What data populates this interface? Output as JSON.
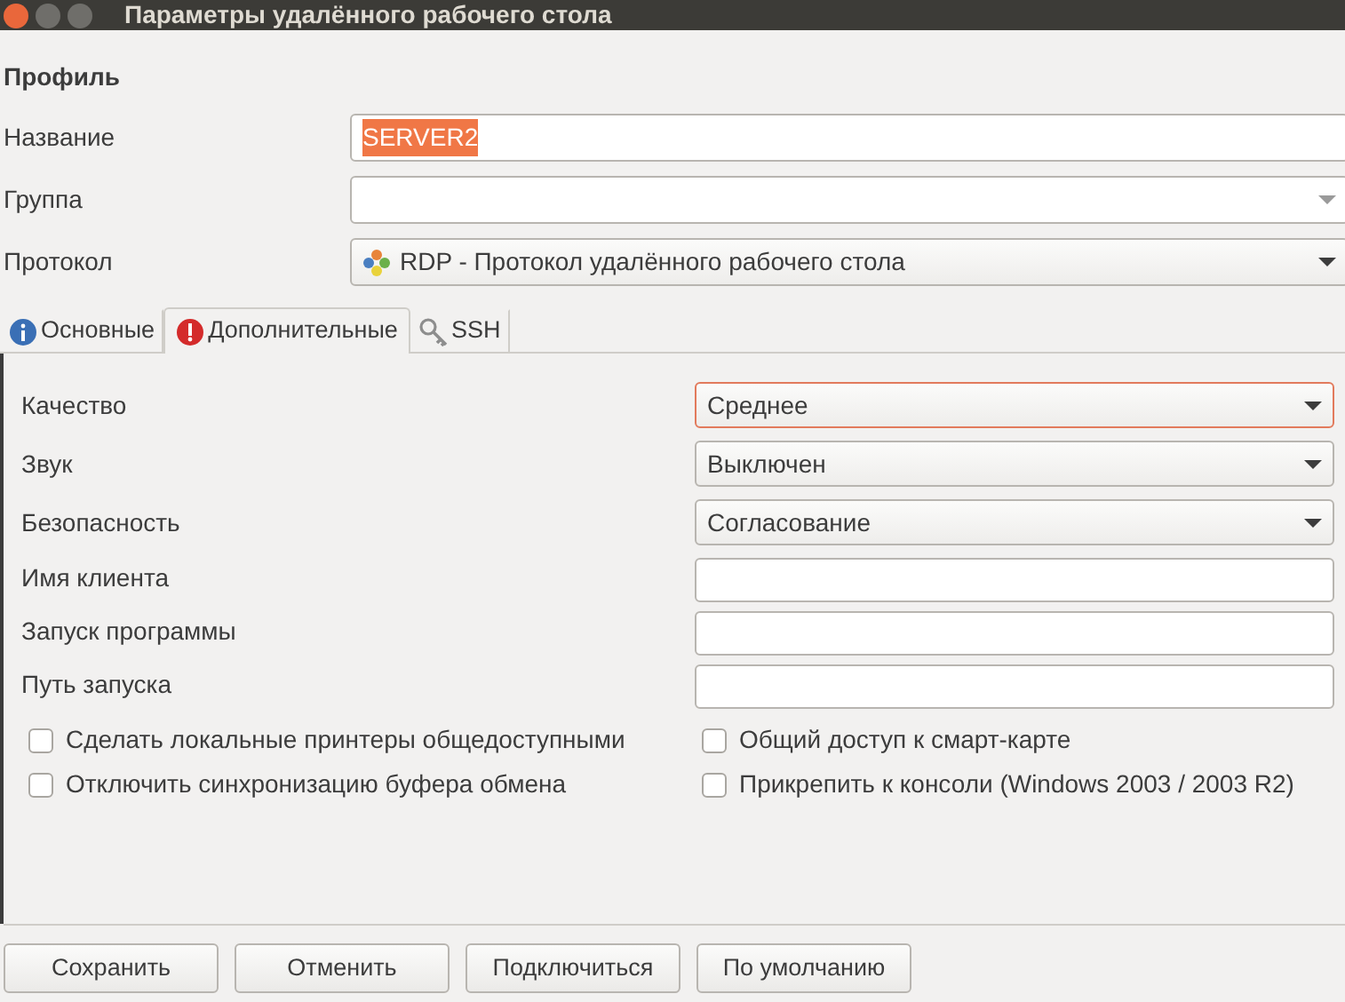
{
  "window": {
    "title": "Параметры удалённого рабочего стола"
  },
  "profile": {
    "heading": "Профиль",
    "fields": [
      {
        "label": "Название",
        "kind": "text",
        "value": "SERVER2",
        "value_selected": true
      },
      {
        "label": "Группа",
        "kind": "entry-combo"
      },
      {
        "label": "Протокол",
        "kind": "combo",
        "value": "RDP - Протокол удалённого рабочего стола"
      }
    ]
  },
  "tabs": [
    {
      "label": "Основные",
      "kind": "info",
      "selected": false
    },
    {
      "label": "Дополнительные",
      "kind": "error",
      "selected": true
    },
    {
      "label": "SSH",
      "kind": "key",
      "selected": false
    }
  ],
  "settings": [
    {
      "label": "Качество",
      "kind": "combo",
      "value": "Среднее",
      "focused": true
    },
    {
      "label": "Звук",
      "kind": "combo",
      "value": "Выключен",
      "focused": false
    },
    {
      "label": "Безопасность",
      "kind": "combo",
      "value": "Согласование",
      "focused": false
    },
    {
      "label": "Имя клиента",
      "kind": "text",
      "focused": false
    },
    {
      "label": "Запуск программы",
      "kind": "text",
      "focused": false
    },
    {
      "label": "Путь запуска",
      "kind": "text",
      "focused": false
    }
  ],
  "checkboxes": [
    {
      "label": "Сделать локальные принтеры общедоступными",
      "checked": false
    },
    {
      "label": "Общий доступ к смарт-карте",
      "checked": false
    },
    {
      "label": "Отключить синхронизацию буфера обмена",
      "checked": false
    },
    {
      "label": "Прикрепить к консоли (Windows 2003 / 2003 R2)",
      "checked": false
    }
  ],
  "buttons": [
    "Сохранить",
    "Отменить",
    "Подключиться",
    "По умолчанию"
  ]
}
